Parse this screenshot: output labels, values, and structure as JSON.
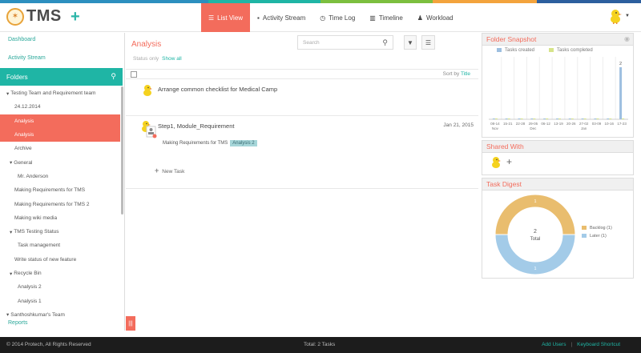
{
  "header": {
    "logo_text": "TMS",
    "nav": [
      {
        "label": "List View",
        "icon": "list-icon"
      },
      {
        "label": "Activity Stream",
        "icon": "comment-icon"
      },
      {
        "label": "Time Log",
        "icon": "clock-icon"
      },
      {
        "label": "Timeline",
        "icon": "bar-chart-icon"
      },
      {
        "label": "Workload",
        "icon": "user-icon"
      }
    ]
  },
  "sidebar": {
    "dashboard": "Dashboard",
    "activity_stream": "Activity Stream",
    "folders_label": "Folders",
    "tree": [
      {
        "label": "Testing Team and Requirement team",
        "indent": 8,
        "caret": true
      },
      {
        "label": "24.12.2014",
        "indent": 18
      },
      {
        "label": "Analysis",
        "indent": 18,
        "selected": true
      },
      {
        "label": "Analysis",
        "indent": 18,
        "selected": true
      },
      {
        "label": "Archive",
        "indent": 18
      },
      {
        "label": "General",
        "indent": 12,
        "caret": true
      },
      {
        "label": "Mr. Anderson",
        "indent": 22
      },
      {
        "label": "Making Requirements for TMS",
        "indent": 18
      },
      {
        "label": "Making Requirements for TMS 2",
        "indent": 18
      },
      {
        "label": "Making wiki media",
        "indent": 18
      },
      {
        "label": "TMS Testing Status",
        "indent": 12,
        "caret": true
      },
      {
        "label": "Task management",
        "indent": 22
      },
      {
        "label": "Write status of new feature",
        "indent": 18
      },
      {
        "label": "Recycle Bin",
        "indent": 12,
        "caret": true
      },
      {
        "label": "Analysis 2",
        "indent": 22
      },
      {
        "label": "Analysis 1",
        "indent": 22
      },
      {
        "label": "Santhoshkumar's Team",
        "indent": 8,
        "caret": true
      }
    ],
    "reports": "Reports"
  },
  "main": {
    "title": "Analysis",
    "subtitle_muted": "Status only",
    "subtitle_link": "Show all",
    "search_placeholder": "Search",
    "sort_label": "Sort by",
    "sort_value": "Title",
    "tasks": [
      {
        "title": "Arrange common checklist for Medical Camp",
        "date": ""
      },
      {
        "title": "Step1, Module_Requirement",
        "date": "Jan 21, 2015",
        "subtask": "Making Requirements for TMS",
        "tag": "Analysis 2"
      }
    ],
    "new_task": "New Task"
  },
  "folder_snapshot": {
    "title": "Folder Snapshot",
    "legend": [
      "Tasks created",
      "Tasks completed"
    ],
    "bar_label": "2"
  },
  "shared_with": {
    "title": "Shared With"
  },
  "task_digest": {
    "title": "Task Digest",
    "center_value": "2",
    "center_label": "Total",
    "legend": [
      "Backlog (1)",
      "Later (1)"
    ],
    "slice_labels": [
      "1",
      "1"
    ]
  },
  "chart_data": [
    {
      "type": "bar",
      "title": "Folder Snapshot",
      "categories": [
        "08-14 Nov",
        "15-21",
        "22-28",
        "29-05 Dec",
        "06-12",
        "13-19",
        "20-26",
        "27-02 Jan",
        "03-09",
        "10-16",
        "17-23"
      ],
      "series": [
        {
          "name": "Tasks created",
          "values": [
            0,
            0,
            0,
            0,
            0,
            0,
            0,
            0,
            0,
            0,
            2
          ]
        },
        {
          "name": "Tasks completed",
          "values": [
            0,
            0,
            0,
            0,
            0,
            0,
            0,
            0,
            0,
            0,
            0
          ]
        }
      ],
      "colors": [
        "#9dbfe0",
        "#d6e48a"
      ]
    },
    {
      "type": "pie",
      "title": "Task Digest",
      "categories": [
        "Backlog",
        "Later"
      ],
      "values": [
        1,
        1
      ],
      "colors": [
        "#e9bd6e",
        "#a3cbe8"
      ]
    }
  ],
  "footer": {
    "copyright": "© 2014 Protech, All Rights Reserved",
    "total": "Total: 2 Tasks",
    "add_users": "Add Users",
    "divider": "|",
    "shortcut": "Keyboard Shortcut"
  },
  "colors": {
    "accent": "#f36c5c",
    "teal": "#1fb5a5"
  }
}
